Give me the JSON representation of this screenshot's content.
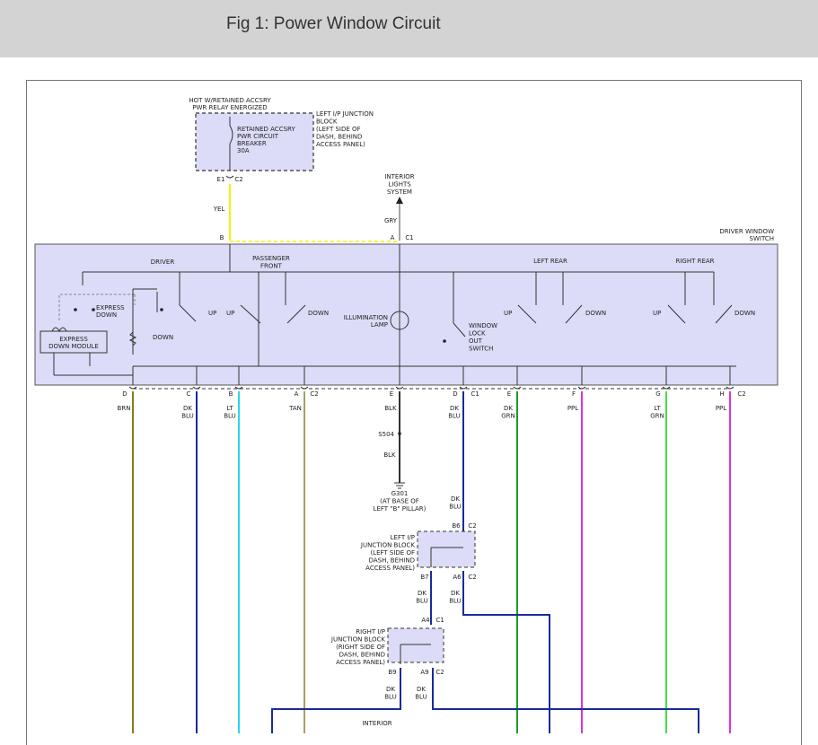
{
  "header": {
    "title": "Fig 1: Power Window Circuit"
  },
  "colors": {
    "switch_fill": "#dcdcf8",
    "wire_yel": "#f2f200",
    "wire_brn": "#8a7a1a",
    "wire_dkblu": "#1a2a9a",
    "wire_ltblu": "#22d8f0",
    "wire_tan": "#a8a060",
    "wire_blk": "#333333",
    "wire_dkgrn": "#1a9a2a",
    "wire_ppl": "#e030e0",
    "wire_ltgrn": "#44e044",
    "wire_gry": "#888888"
  },
  "diagram": {
    "hot_label": [
      "HOT W/RETAINED ACCSRY",
      "PWR RELAY ENERGIZED"
    ],
    "breaker_label": [
      "RETAINED ACCSRY",
      "PWR CIRCUIT",
      "BREAKER",
      "30A"
    ],
    "left_jb_label": [
      "LEFT I/P JUNCTION",
      "BLOCK",
      "(LEFT SIDE OF",
      "DASH, BEHIND",
      "ACCESS PANEL)"
    ],
    "e1": "E1",
    "c2": "C2",
    "c1": "C1",
    "yel": "YEL",
    "gry": "GRY",
    "interior_lights": [
      "INTERIOR",
      "LIGHTS",
      "SYSTEM"
    ],
    "pin_b": "B",
    "pin_a": "A",
    "driver_switch_label": [
      "DRIVER WINDOW",
      "SWITCH"
    ],
    "driver": "DRIVER",
    "passenger_front": [
      "PASSENGER",
      "FRONT"
    ],
    "left_rear": "LEFT REAR",
    "right_rear": "RIGHT REAR",
    "express_down": [
      "EXPRESS",
      "DOWN"
    ],
    "express_down_module": [
      "EXPRESS",
      "DOWN MODULE"
    ],
    "up": "UP",
    "down": "DOWN",
    "illumination_lamp": [
      "ILLUMINATION",
      "LAMP"
    ],
    "window_lock": [
      "WINDOW",
      "LOCK",
      "OUT",
      "SWITCH"
    ],
    "bottom_pins": [
      "D",
      "C",
      "B",
      "A",
      "E",
      "D",
      "E",
      "F",
      "G",
      "H"
    ],
    "wires": [
      [
        "BRN"
      ],
      [
        "DK",
        "BLU"
      ],
      [
        "LT",
        "BLU"
      ],
      [
        "TAN"
      ],
      [
        "BLK"
      ],
      [
        "DK",
        "BLU"
      ],
      [
        "DK",
        "GRN"
      ],
      [
        "PPL"
      ],
      [
        "LT",
        "GRN"
      ],
      [
        "PPL"
      ]
    ],
    "s504": "S504",
    "blk": "BLK",
    "g301": [
      "G301",
      "(AT BASE OF",
      "LEFT \"B\" PILLAR)"
    ],
    "dk_blu": [
      "DK",
      "BLU"
    ],
    "b6": "B6",
    "b7": "B7",
    "a6": "A6",
    "a4": "A4",
    "b9": "B9",
    "a9": "A9",
    "left_ip_jb2": [
      "LEFT I/P",
      "JUNCTION BLOCK",
      "(LEFT SIDE OF",
      "DASH, BEHIND",
      "ACCESS PANEL)"
    ],
    "right_ip_jb": [
      "RIGHT I/P",
      "JUNCTION BLOCK",
      "(RIGHT SIDE OF",
      "DASH, BEHIND",
      "ACCESS PANEL)"
    ],
    "cut_label": "INTERIOR"
  }
}
